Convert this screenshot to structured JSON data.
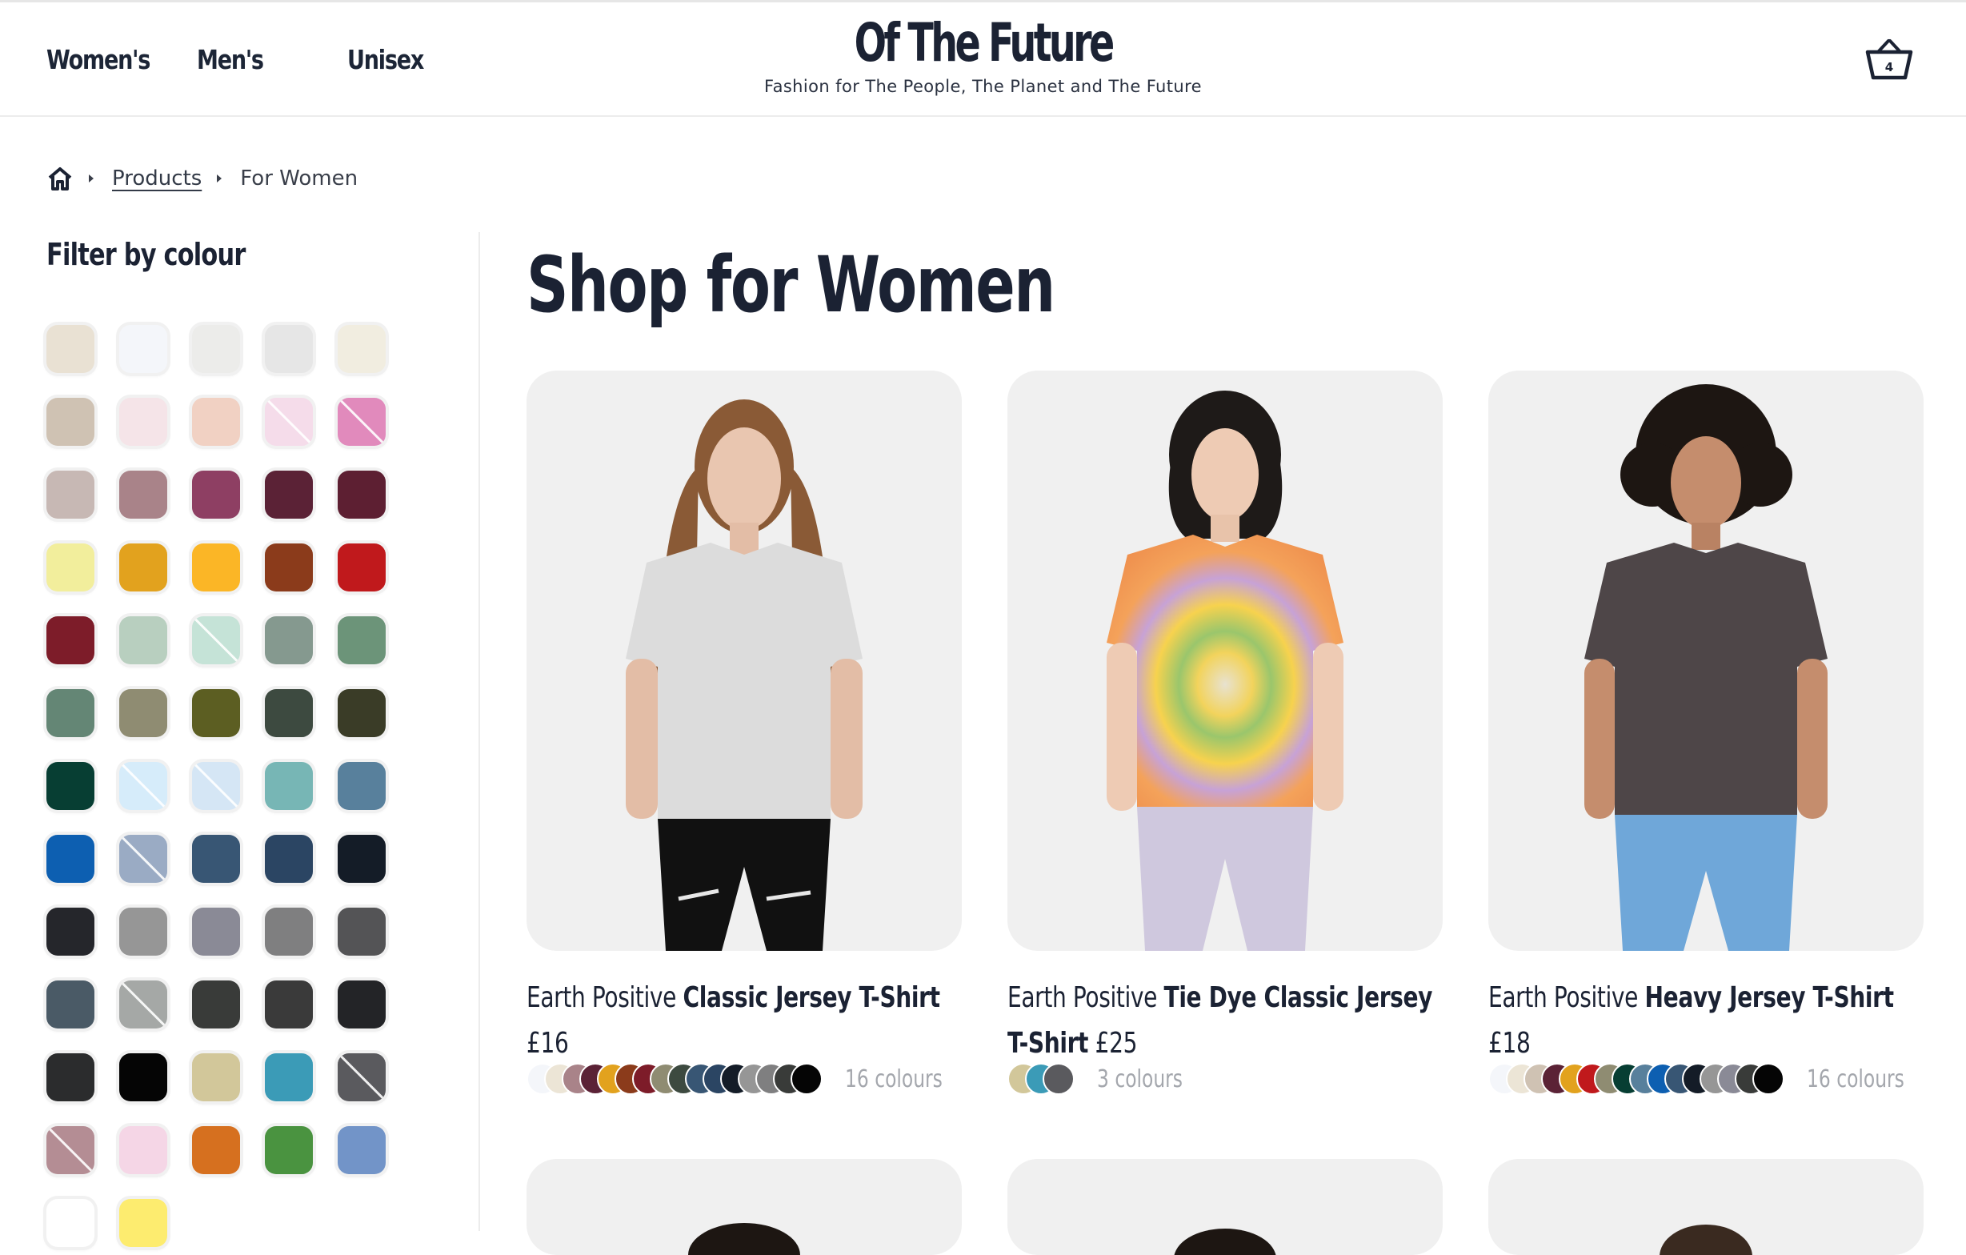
{
  "header": {
    "nav": [
      "Women's",
      "Men's",
      "Unisex"
    ],
    "logo": "Of The Future",
    "tagline": "Fashion for The People, The Planet and The Future",
    "cart_count": "4"
  },
  "breadcrumb": {
    "home_icon": "home-icon",
    "products": "Products",
    "current": "For Women"
  },
  "filter": {
    "title": "Filter by colour",
    "swatches": [
      {
        "c": "#e9e1d3"
      },
      {
        "c": "#f4f6fa"
      },
      {
        "c": "#ececea"
      },
      {
        "c": "#e6e6e6"
      },
      {
        "c": "#f1ede0"
      },
      {
        "c": "#cfc2b3"
      },
      {
        "c": "#f5e4e8"
      },
      {
        "c": "#f1d1c3"
      },
      {
        "c": "#f5dcea",
        "slash": true
      },
      {
        "c": "#e18abc",
        "slash": true
      },
      {
        "c": "#c7b8b4"
      },
      {
        "c": "#a98389"
      },
      {
        "c": "#8e3f63"
      },
      {
        "c": "#5b2236"
      },
      {
        "c": "#5d1f32"
      },
      {
        "c": "#f2ee9c"
      },
      {
        "c": "#e2a21e"
      },
      {
        "c": "#fbb626"
      },
      {
        "c": "#8b3b1b"
      },
      {
        "c": "#c0191c"
      },
      {
        "c": "#7d1c29"
      },
      {
        "c": "#b8cfbf"
      },
      {
        "c": "#c5e3d7",
        "slash": true
      },
      {
        "c": "#85998f"
      },
      {
        "c": "#6c9479"
      },
      {
        "c": "#648675"
      },
      {
        "c": "#8f8c72"
      },
      {
        "c": "#5c5e22"
      },
      {
        "c": "#3d4a40"
      },
      {
        "c": "#3a3c27"
      },
      {
        "c": "#073e33"
      },
      {
        "c": "#d6ecfa",
        "slash": true
      },
      {
        "c": "#d5e6f5",
        "slash": true
      },
      {
        "c": "#77b6b5"
      },
      {
        "c": "#58809c"
      },
      {
        "c": "#0d5fb1"
      },
      {
        "c": "#9aabc4",
        "slash": true
      },
      {
        "c": "#385674"
      },
      {
        "c": "#2b4563"
      },
      {
        "c": "#141c27"
      },
      {
        "c": "#25262b"
      },
      {
        "c": "#969696"
      },
      {
        "c": "#8a8a96"
      },
      {
        "c": "#7f7f80"
      },
      {
        "c": "#545456"
      },
      {
        "c": "#4a5a66"
      },
      {
        "c": "#a5a8a6",
        "slash": true
      },
      {
        "c": "#393b39"
      },
      {
        "c": "#3a3a3a"
      },
      {
        "c": "#232427"
      },
      {
        "c": "#2b2c2d"
      },
      {
        "c": "#050505"
      },
      {
        "c": "#d2c79a"
      },
      {
        "c": "#3b9bb7"
      },
      {
        "c": "#5a5a5e",
        "slash": true
      },
      {
        "c": "#b48d94",
        "slash": true
      },
      {
        "c": "#f5d6e6"
      },
      {
        "c": "#d6701f"
      },
      {
        "c": "#4a9340"
      },
      {
        "c": "#7294c8"
      },
      {
        "c": "#ffffff"
      },
      {
        "c": "#fdec6f"
      }
    ]
  },
  "main": {
    "title": "Shop for Women",
    "products": [
      {
        "brand": "Earth Positive",
        "name": "Classic Jersey T-Shirt",
        "price": "£16",
        "colours_label": "16 colours",
        "dots": [
          "#f4f6fa",
          "#ece5d6",
          "#a98389",
          "#5b2236",
          "#e2a21e",
          "#8b3b1b",
          "#7d1c29",
          "#8f8c72",
          "#3d4a40",
          "#385674",
          "#2b4563",
          "#141c27",
          "#969696",
          "#7f7f80",
          "#393b39",
          "#050505"
        ]
      },
      {
        "brand": "Earth Positive",
        "name": "Tie Dye Classic Jersey T-Shirt",
        "price": "£25",
        "colours_label": "3 colours",
        "dots": [
          "#d2c79a",
          "#3b9bb7",
          "#5a5a5e"
        ]
      },
      {
        "brand": "Earth Positive",
        "name": "Heavy Jersey T-Shirt",
        "price": "£18",
        "colours_label": "16 colours",
        "dots": [
          "#f4f6fa",
          "#ece5d6",
          "#cfc2b3",
          "#5b2236",
          "#e2a21e",
          "#c0191c",
          "#8f8c72",
          "#073e33",
          "#58809c",
          "#0d5fb1",
          "#385674",
          "#141c27",
          "#969696",
          "#8a8a96",
          "#393b39",
          "#050505"
        ]
      }
    ]
  },
  "colors": {
    "text": "#1b2233",
    "muted": "#a4a7ad",
    "card_bg": "#f0f0f0"
  }
}
